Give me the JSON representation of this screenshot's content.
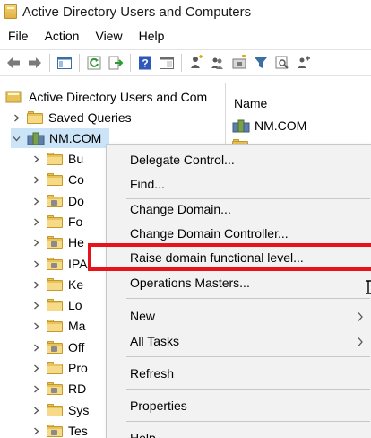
{
  "window": {
    "title": "Active Directory Users and Computers"
  },
  "menubar": {
    "items": [
      "File",
      "Action",
      "View",
      "Help"
    ]
  },
  "toolbar": {
    "buttons": [
      "back-arrow-icon",
      "forward-arrow-icon",
      "show-hide-console-tree-icon",
      "refresh-icon",
      "export-list-icon",
      "help-icon",
      "properties-icon",
      "create-user-icon",
      "create-group-icon",
      "create-ou-icon",
      "filter-icon",
      "find-icon",
      "add-to-group-icon"
    ]
  },
  "tree": {
    "root_label": "Active Directory Users and Com",
    "saved_queries_label": "Saved Queries",
    "domain_label": "NM.COM",
    "children": [
      {
        "label": "Bu",
        "type": "container"
      },
      {
        "label": "Co",
        "type": "container"
      },
      {
        "label": "Do",
        "type": "ou"
      },
      {
        "label": "Fo",
        "type": "container"
      },
      {
        "label": "He",
        "type": "ou"
      },
      {
        "label": "IPA",
        "type": "ou"
      },
      {
        "label": "Ke",
        "type": "container"
      },
      {
        "label": "Lo",
        "type": "container"
      },
      {
        "label": "Ma",
        "type": "container"
      },
      {
        "label": "Off",
        "type": "ou"
      },
      {
        "label": "Pro",
        "type": "container"
      },
      {
        "label": "RD",
        "type": "ou"
      },
      {
        "label": "Sys",
        "type": "container"
      },
      {
        "label": "Tes",
        "type": "ou"
      }
    ]
  },
  "list": {
    "column_name": "Name",
    "rows": [
      "NM.COM"
    ]
  },
  "context_menu": {
    "items": {
      "delegate_control": "Delegate Control...",
      "find": "Find...",
      "change_domain": "Change Domain...",
      "change_domain_controller": "Change Domain Controller...",
      "raise_level": "Raise domain functional level...",
      "operations_masters": "Operations Masters...",
      "new": "New",
      "all_tasks": "All Tasks",
      "refresh": "Refresh",
      "properties": "Properties",
      "help": "Help"
    }
  },
  "colors": {
    "highlight_border": "#e8131a",
    "selection": "#cce4f7",
    "menu_background": "#f2f2f2",
    "folder": "#e8c25a"
  }
}
